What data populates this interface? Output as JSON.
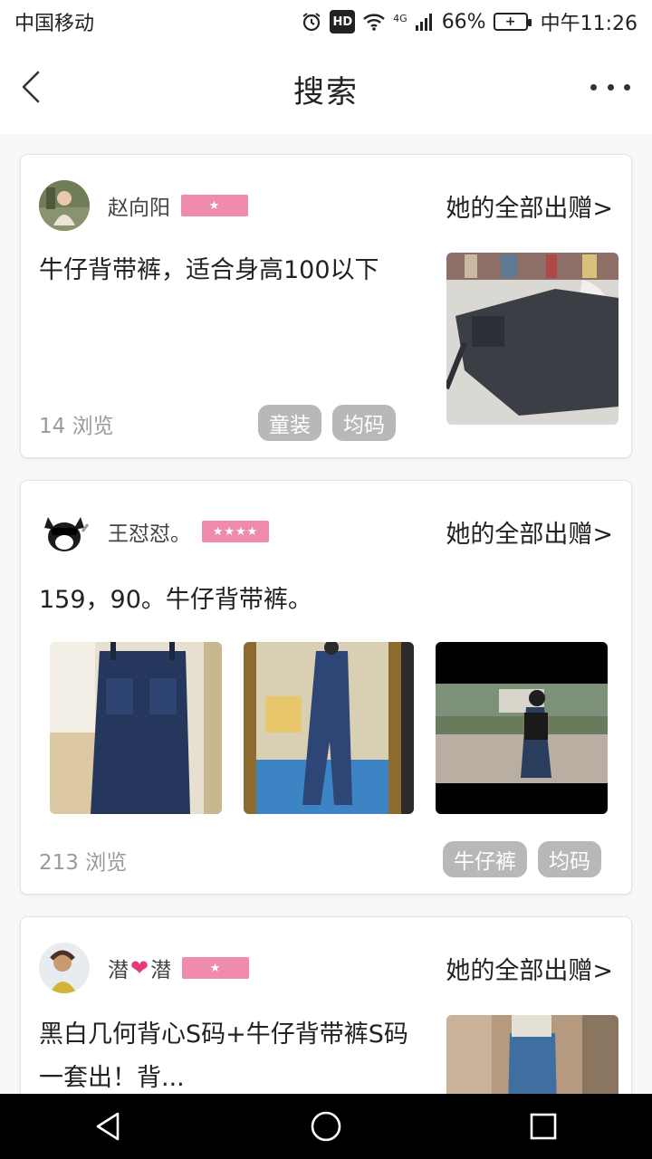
{
  "status_bar": {
    "carrier": "中国移动",
    "network": "4G",
    "hd": "HD",
    "battery_percent": "66%",
    "time": "中午11:26"
  },
  "nav": {
    "title": "搜索"
  },
  "posts": [
    {
      "user": "赵向阳",
      "level_stars": "★",
      "all_link": "她的全部出赠>",
      "description": "牛仔背带裤，适合身高100以下",
      "views": "14 浏览",
      "tags": [
        "童装",
        "均码"
      ]
    },
    {
      "user": "王怼怼。",
      "level_stars": "★★★★",
      "all_link": "她的全部出赠>",
      "description": "159，90。牛仔背带裤。",
      "views": "213 浏览",
      "tags": [
        "牛仔裤",
        "均码"
      ]
    },
    {
      "user_part1": "潜",
      "user_part2": "潜",
      "level_stars": "★",
      "all_link": "她的全部出赠>",
      "description": "黑白几何背心S码+牛仔背带裤S码一套出！背..."
    }
  ],
  "colors": {
    "badge": "#f08bb0",
    "tag_bg": "#b8b8b8",
    "views_text": "#9a9a9a",
    "heart": "#e63b7a"
  }
}
